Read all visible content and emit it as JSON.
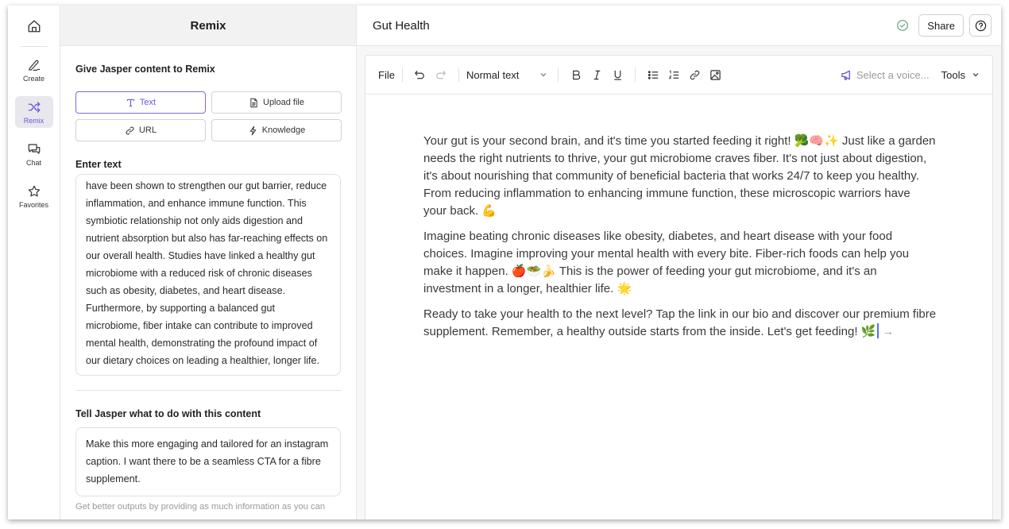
{
  "rail": {
    "home_label": "Home",
    "items": [
      {
        "label": "Create",
        "icon": "pen-icon"
      },
      {
        "label": "Remix",
        "icon": "shuffle-icon",
        "active": true
      },
      {
        "label": "Chat",
        "icon": "chat-icon"
      },
      {
        "label": "Favorites",
        "icon": "star-icon"
      }
    ]
  },
  "remix": {
    "title": "Remix",
    "give_label": "Give Jasper content to Remix",
    "sources": [
      {
        "label": "Text",
        "icon": "text-icon",
        "active": true
      },
      {
        "label": "Upload file",
        "icon": "file-icon"
      },
      {
        "label": "URL",
        "icon": "link-icon"
      },
      {
        "label": "Knowledge",
        "icon": "bolt-icon"
      }
    ],
    "enter_text_label": "Enter text",
    "source_text": "have been shown to strengthen our gut barrier, reduce inflammation, and enhance immune function. This symbiotic relationship not only aids digestion and nutrient absorption but also has far-reaching effects on our overall health. Studies have linked a healthy gut microbiome with a reduced risk of chronic diseases such as obesity, diabetes, and heart disease. Furthermore, by supporting a balanced gut microbiome, fiber intake can contribute to improved mental health, demonstrating the profound impact of our dietary choices on leading a healthier, longer life.",
    "tell_label": "Tell Jasper what to do with this content",
    "prompt_text": "Make this more engaging and tailored for an instagram caption. I want there to be a seamless CTA for a fibre supplement.",
    "hint": "Get better outputs by providing as much information as you can"
  },
  "doc": {
    "title": "Gut Health",
    "share_label": "Share",
    "saved_status": "saved",
    "toolbar": {
      "file_label": "File",
      "text_style": "Normal text",
      "voice_placeholder": "Select a voice...",
      "tools_label": "Tools"
    },
    "paragraphs": [
      "Your gut is your second brain, and it's time you started feeding it right! 🥦🧠✨ Just like a garden needs the right nutrients to thrive, your gut microbiome craves fiber. It's not just about digestion, it's about nourishing that community of beneficial bacteria that works 24/7 to keep you healthy. From reducing inflammation to enhancing immune function, these microscopic warriors have your back. 💪",
      "Imagine beating chronic diseases like obesity, diabetes, and heart disease with your food choices. Imagine improving your mental health with every bite. Fiber-rich foods can help you make it happen. 🍎🥗🍌 This is the power of feeding your gut microbiome, and it's an investment in a longer, healthier life. 🌟",
      "Ready to take your health to the next level? Tap the link in our bio and discover our premium fibre supplement. Remember, a healthy outside starts from the inside. Let's get feeding! 🌿"
    ],
    "suggest_arrow": "→"
  }
}
